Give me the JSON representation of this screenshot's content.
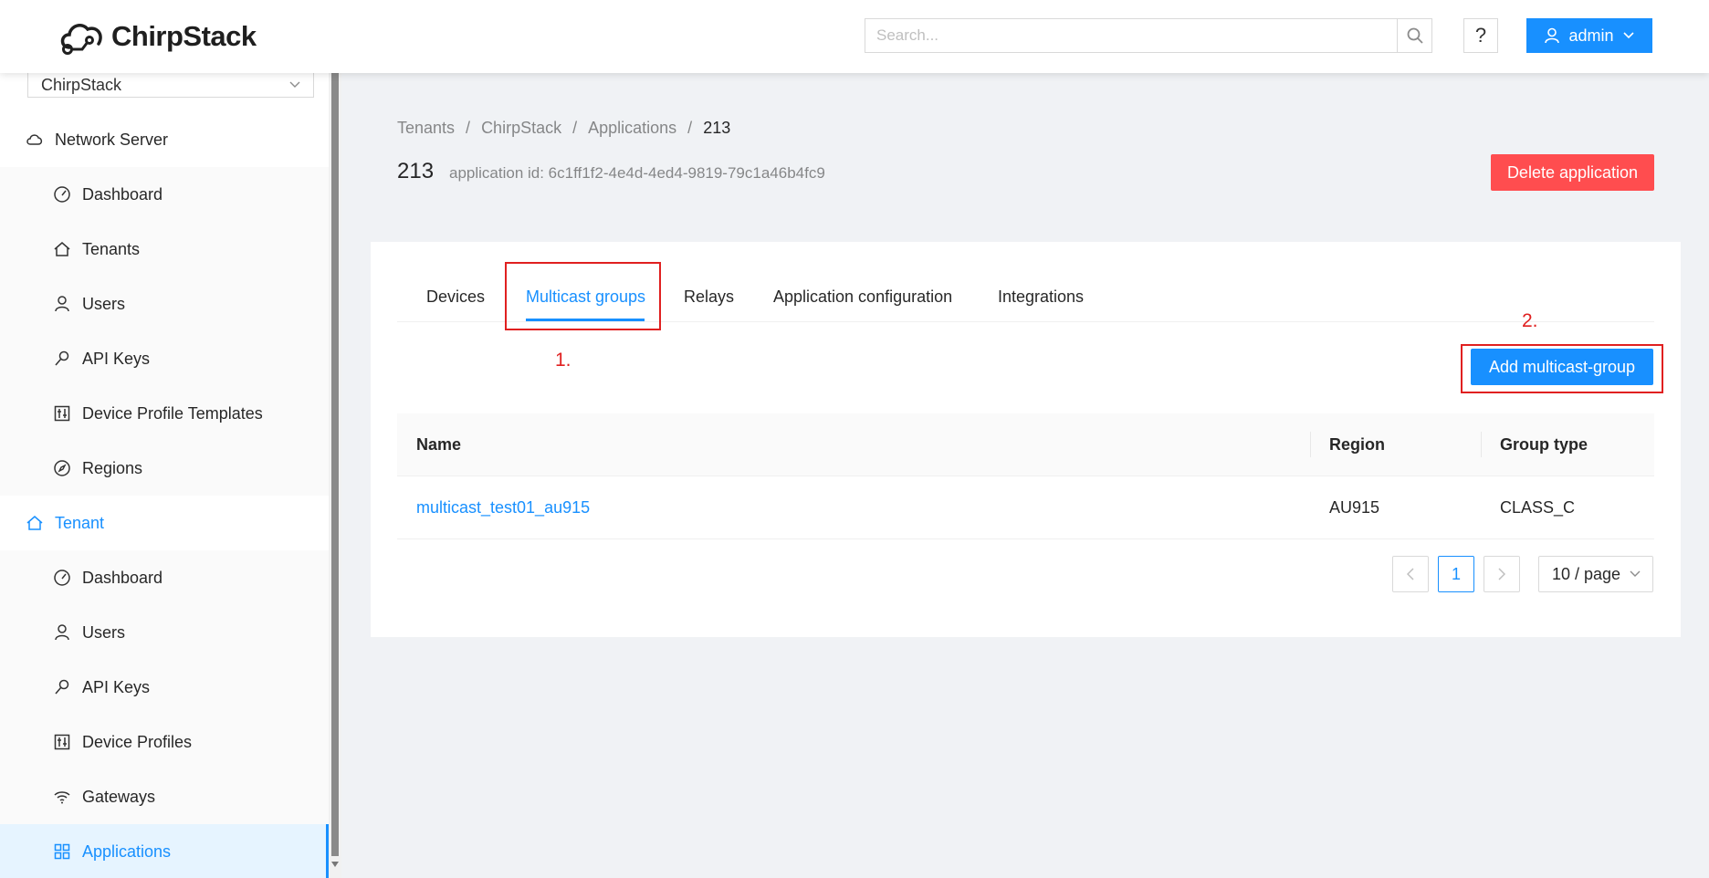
{
  "brand": {
    "name": "ChirpStack"
  },
  "header": {
    "search_placeholder": "Search...",
    "help_label": "?",
    "user_label": "admin"
  },
  "sidebar": {
    "tenant_select": "ChirpStack",
    "network_server_label": "Network Server",
    "network_server_items": [
      {
        "label": "Dashboard",
        "icon": "dashboard-icon"
      },
      {
        "label": "Tenants",
        "icon": "home-icon"
      },
      {
        "label": "Users",
        "icon": "user-icon"
      },
      {
        "label": "API Keys",
        "icon": "key-icon"
      },
      {
        "label": "Device Profile Templates",
        "icon": "sliders-icon"
      },
      {
        "label": "Regions",
        "icon": "compass-icon"
      }
    ],
    "tenant_label": "Tenant",
    "tenant_items": [
      {
        "label": "Dashboard",
        "icon": "dashboard-icon"
      },
      {
        "label": "Users",
        "icon": "user-icon"
      },
      {
        "label": "API Keys",
        "icon": "key-icon"
      },
      {
        "label": "Device Profiles",
        "icon": "sliders-icon"
      },
      {
        "label": "Gateways",
        "icon": "wifi-icon"
      },
      {
        "label": "Applications",
        "icon": "grid-icon"
      }
    ]
  },
  "breadcrumb": [
    "Tenants",
    "ChirpStack",
    "Applications",
    "213"
  ],
  "page": {
    "title": "213",
    "subtitle": "application id: 6c1ff1f2-4e4d-4ed4-9819-79c1a46b4fc9",
    "delete_label": "Delete application"
  },
  "tabs": [
    {
      "label": "Devices",
      "active": false
    },
    {
      "label": "Multicast groups",
      "active": true
    },
    {
      "label": "Relays",
      "active": false
    },
    {
      "label": "Application configuration",
      "active": false
    },
    {
      "label": "Integrations",
      "active": false
    }
  ],
  "annotations": {
    "step1": "1.",
    "step2": "2."
  },
  "add_button_label": "Add multicast-group",
  "table": {
    "columns": [
      "Name",
      "Region",
      "Group type"
    ],
    "rows": [
      {
        "name": "multicast_test01_au915",
        "region": "AU915",
        "group_type": "CLASS_C"
      }
    ]
  },
  "pagination": {
    "current_page": "1",
    "page_size": "10 / page"
  },
  "colors": {
    "primary": "#1890ff",
    "danger": "#ff4d4f",
    "annotation": "#e02020"
  }
}
